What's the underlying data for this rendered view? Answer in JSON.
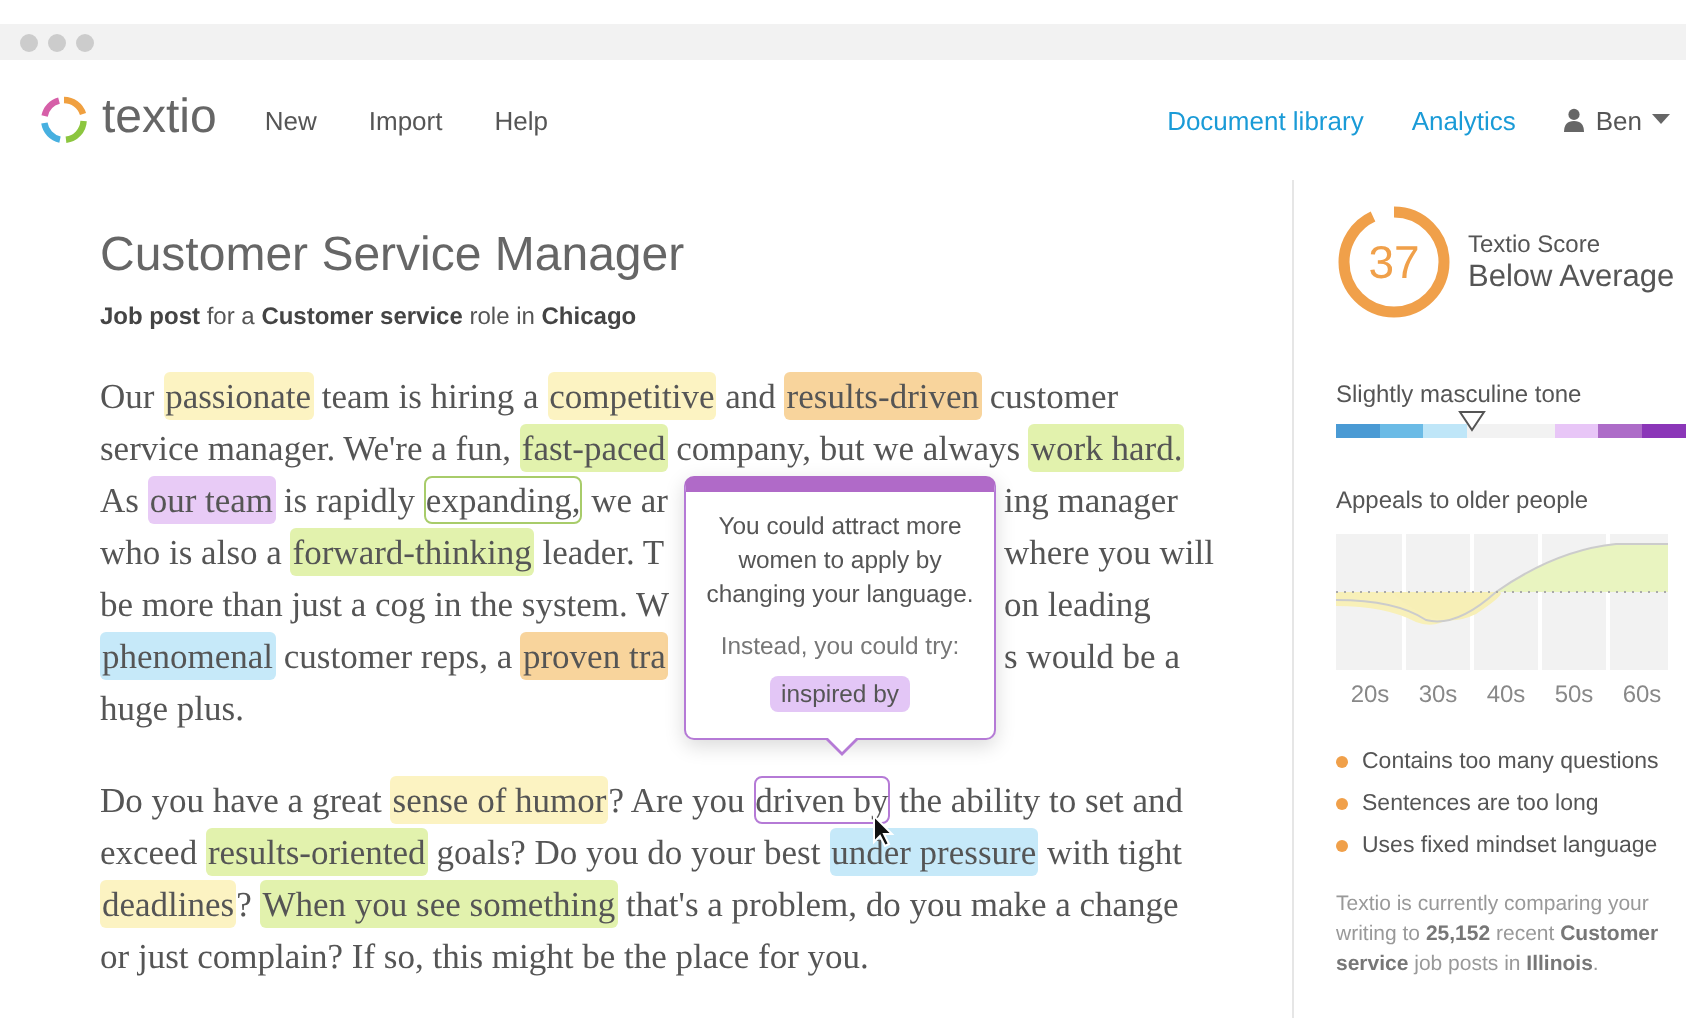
{
  "app": {
    "logo": "textio",
    "nav": [
      "New",
      "Import",
      "Help"
    ],
    "links": [
      "Document library",
      "Analytics"
    ],
    "user": "Ben"
  },
  "document": {
    "title": "Customer Service Manager",
    "subtitle": "**Job post** for a **Customer service** role in **Chicago**",
    "paragraphs": [
      [
        {
          "left": [
            {
              "kind": "plain",
              "text": "Our "
            },
            {
              "kind": "highlight",
              "text": "passionate",
              "color": "#fcf3c2"
            },
            {
              "kind": "plain",
              "text": " team is hiring a "
            },
            {
              "kind": "highlight",
              "text": "competitive",
              "color": "#fcf3c2"
            },
            {
              "kind": "plain",
              "text": " and "
            },
            {
              "kind": "highlight",
              "text": "results-driven",
              "color": "#f8d49c"
            },
            {
              "kind": "plain",
              "text": " customer"
            }
          ]
        },
        {
          "left": [
            {
              "kind": "plain",
              "text": "service manager. We're a fun, "
            },
            {
              "kind": "highlight",
              "text": "fast-paced",
              "color": "#e2f2ad"
            },
            {
              "kind": "plain",
              "text": " company, but we always "
            },
            {
              "kind": "highlight",
              "text": "work hard.",
              "color": "#e2f2ad"
            }
          ]
        },
        {
          "left": [
            {
              "kind": "plain",
              "text": "As "
            },
            {
              "kind": "highlight",
              "text": "our team",
              "color": "#e8cbf6"
            },
            {
              "kind": "plain",
              "text": " is rapidly "
            },
            {
              "kind": "outline",
              "text": "expanding,",
              "color": "#a8cc6a"
            },
            {
              "kind": "plain",
              "text": " we ar"
            }
          ],
          "right": [
            {
              "text": "ing manager"
            }
          ]
        },
        {
          "left": [
            {
              "kind": "plain",
              "text": "who is also a "
            },
            {
              "kind": "highlight",
              "text": "forward-thinking",
              "color": "#e2f2ad"
            },
            {
              "kind": "plain",
              "text": " leader. T"
            }
          ],
          "right": [
            {
              "text": "where you will"
            }
          ]
        },
        {
          "left": [
            {
              "kind": "plain",
              "text": "be more than just a cog in the system. W"
            }
          ],
          "right": [
            {
              "text": "on leading"
            }
          ]
        },
        {
          "left": [
            {
              "kind": "highlight",
              "text": "phenomenal",
              "color": "#c6e9f9"
            },
            {
              "kind": "plain",
              "text": " customer reps, a "
            },
            {
              "kind": "highlight",
              "text": "proven tra",
              "color": "#f8d49c"
            }
          ],
          "right": [
            {
              "text": "s would be a"
            }
          ]
        },
        {
          "left": [
            {
              "kind": "plain",
              "text": "huge plus."
            }
          ]
        }
      ],
      [
        {
          "left": [
            {
              "kind": "plain",
              "text": "Do you have a great "
            },
            {
              "kind": "highlight",
              "text": "sense of humor",
              "color": "#fcf3c2"
            },
            {
              "kind": "plain",
              "text": "? Are you "
            },
            {
              "kind": "outline",
              "text": "driven by",
              "color": "#b57ad6"
            },
            {
              "kind": "plain",
              "text": " the ability to set and"
            }
          ]
        },
        {
          "left": [
            {
              "kind": "plain",
              "text": "exceed "
            },
            {
              "kind": "highlight",
              "text": "results-oriented",
              "color": "#e2f2ad"
            },
            {
              "kind": "plain",
              "text": " goals? Do you do your best "
            },
            {
              "kind": "highlight",
              "text": "under pressure",
              "color": "#c6e9f9"
            },
            {
              "kind": "plain",
              "text": " with tight"
            }
          ]
        },
        {
          "left": [
            {
              "kind": "highlight",
              "text": "deadlines",
              "color": "#fcf3c2"
            },
            {
              "kind": "plain",
              "text": "? "
            },
            {
              "kind": "highlight",
              "text": "When you see something",
              "color": "#e2f2ad"
            },
            {
              "kind": "plain",
              "text": " that's a problem, do you make a change"
            }
          ]
        },
        {
          "left": [
            {
              "kind": "plain",
              "text": "or just complain? If so, this might be the place for you."
            }
          ]
        }
      ]
    ]
  },
  "popup": {
    "message": "You could attract more women to apply by changing your language.",
    "hint": "Instead, you could try:",
    "suggestion": "inspired by"
  },
  "sidebar": {
    "score": "37",
    "score_label": "Textio Score",
    "score_rating": "Below Average",
    "tone": {
      "label": "Slightly masculine tone",
      "level": 0.39
    },
    "age": {
      "label": "Appeals to older people",
      "axis": [
        "20s",
        "30s",
        "40s",
        "50s",
        "60s"
      ]
    },
    "issues": [
      "Contains too many questions",
      "Sentences are too long",
      "Uses fixed mindset language"
    ],
    "footer": "Textio is currently comparing your writing to **25,152** recent **Customer service** job posts in **Illinois**."
  }
}
